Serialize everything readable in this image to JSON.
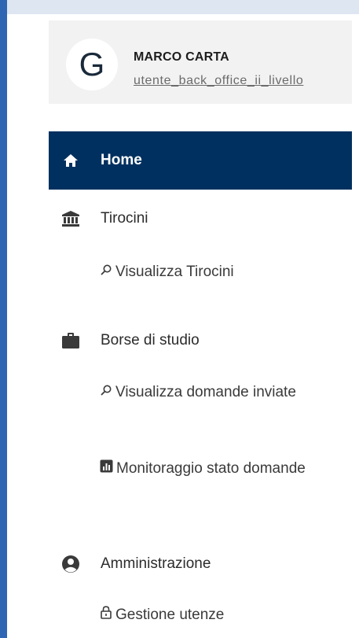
{
  "user": {
    "avatar_letter": "G",
    "name": "MARCO CARTA",
    "role": "utente_back_office_ii_livello"
  },
  "colors": {
    "active_bg": "#00305f",
    "frame_accent": "#2f66b3"
  },
  "nav": {
    "home": {
      "label": "Home",
      "icon": "home-icon"
    },
    "tirocini": {
      "label": "Tirocini",
      "icon": "institution-icon",
      "sub": [
        {
          "label": "Visualizza Tirocini",
          "icon": "search-icon"
        }
      ]
    },
    "borse": {
      "label": "Borse di studio",
      "icon": "briefcase-icon",
      "sub": [
        {
          "label": "Visualizza domande inviate",
          "icon": "search-icon"
        },
        {
          "label": "Monitoraggio stato domande",
          "icon": "chart-icon"
        }
      ]
    },
    "amministrazione": {
      "label": "Amministrazione",
      "icon": "user-circle-icon",
      "sub": [
        {
          "label": "Gestione utenze",
          "icon": "lock-icon"
        }
      ]
    }
  }
}
